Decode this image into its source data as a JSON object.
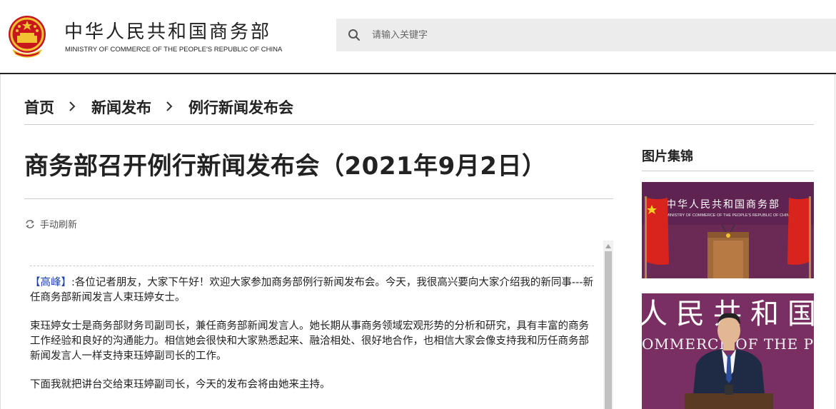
{
  "header": {
    "ministry_cn": "中华人民共和国商务部",
    "ministry_en": "MINISTRY OF COMMERCE OF THE PEOPLE'S REPUBLIC OF CHINA",
    "search_placeholder": "请输入关键字"
  },
  "breadcrumb": [
    "首页",
    "新闻发布",
    "例行新闻发布会"
  ],
  "article": {
    "title": "商务部召开例行新闻发布会（2021年9月2日）",
    "refresh_label": "手动刷新"
  },
  "live": {
    "speaker": "【高峰】",
    "first_text": ":各位记者朋友，大家下午好！欢迎大家参加商务部例行新闻发布会。今天，我很高兴要向大家介绍我的新同事---新任商务部新闻发言人束珏婷女士。",
    "para2": "束珏婷女士是商务部财务司副司长，兼任商务部新闻发言人。她长期从事商务领域宏观形势的分析和研究，具有丰富的商务工作经验和良好的沟通能力。相信她会很快和大家熟悉起来、融洽相处、很好地合作，也相信大家会像支持我和历任商务部新闻发言人一样支持束珏婷副司长的工作。",
    "para3": "下面我就把讲台交给束珏婷副司长，今天的发布会将由她来主持。"
  },
  "sidebar": {
    "title": "图片集锦",
    "photo1_banner_cn": "中华人民共和国商务部",
    "photo1_banner_en": "MINISTRY OF COMMERCE OF THE PEOPLE'S REPUBLIC OF CHINA",
    "photo2_banner_cn": "人民共和国",
    "photo2_banner_en": "OMMERCE OF THE PEOPLE"
  },
  "colors": {
    "speaker_blue": "#1a3fae",
    "backdrop": "#6b2a56",
    "flag_red": "#d8241c"
  }
}
